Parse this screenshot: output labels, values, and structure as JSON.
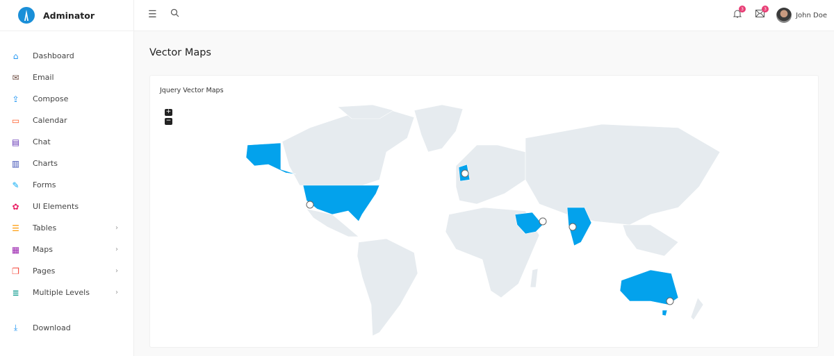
{
  "brand": {
    "name": "Adminator"
  },
  "sidebar": {
    "items": [
      {
        "label": "Dashboard",
        "icon": "home-icon",
        "color": "#2196f3",
        "chevron": false
      },
      {
        "label": "Email",
        "icon": "mail-icon",
        "color": "#6d4c41",
        "chevron": false
      },
      {
        "label": "Compose",
        "icon": "share-icon",
        "color": "#2196f3",
        "chevron": false
      },
      {
        "label": "Calendar",
        "icon": "calendar-icon",
        "color": "#ff5722",
        "chevron": false
      },
      {
        "label": "Chat",
        "icon": "chat-icon",
        "color": "#673ab7",
        "chevron": false
      },
      {
        "label": "Charts",
        "icon": "bar-chart-icon",
        "color": "#3f51b5",
        "chevron": false
      },
      {
        "label": "Forms",
        "icon": "pencil-icon",
        "color": "#03a9f4",
        "chevron": false
      },
      {
        "label": "UI Elements",
        "icon": "palette-icon",
        "color": "#e91e63",
        "chevron": false
      },
      {
        "label": "Tables",
        "icon": "table-icon",
        "color": "#ff9800",
        "chevron": true
      },
      {
        "label": "Maps",
        "icon": "map-icon",
        "color": "#9c27b0",
        "chevron": true
      },
      {
        "label": "Pages",
        "icon": "files-icon",
        "color": "#f44336",
        "chevron": true
      },
      {
        "label": "Multiple Levels",
        "icon": "layers-icon",
        "color": "#009688",
        "chevron": true
      },
      {
        "label": "Download",
        "icon": "download-icon",
        "color": "#2196f3",
        "chevron": false
      }
    ]
  },
  "topbar": {
    "notifications_count": "3",
    "messages_count": "3",
    "user_name": "John Doe"
  },
  "main": {
    "title": "Vector Maps",
    "card_title": "Jquery Vector Maps",
    "zoom_in": "+",
    "zoom_out": "−"
  },
  "map": {
    "base_color": "#e6ebef",
    "highlight_color": "#03a2ec",
    "highlighted_regions": [
      "United States",
      "United Kingdom",
      "Saudi Arabia",
      "India",
      "Australia"
    ],
    "markers": [
      "Los Angeles",
      "London",
      "Dubai",
      "India (center)",
      "Sydney"
    ]
  }
}
